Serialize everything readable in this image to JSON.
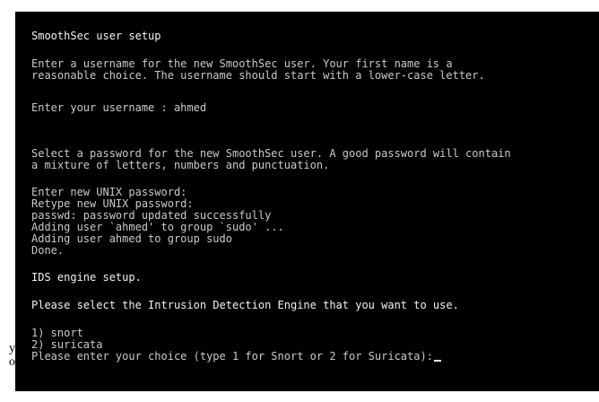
{
  "terminal": {
    "lines": [
      "SmoothSec user setup",
      "Enter a username for the new SmoothSec user. Your first name is a",
      "reasonable choice. The username should start with a lower-case letter.",
      "Enter your username : ahmed",
      "Select a password for the new SmoothSec user. A good password will contain",
      "a mixture of letters, numbers and punctuation.",
      "Enter new UNIX password:",
      "Retype new UNIX password:",
      "passwd: password updated successfully",
      "Adding user `ahmed' to group `sudo' ...",
      "Adding user ahmed to group sudo",
      "Done.",
      "IDS engine setup.",
      "Please select the Intrusion Detection Engine that you want to use.",
      "1) snort",
      "2) suricata",
      "Please enter your choice (type 1 for Snort or 2 for Suricata):"
    ]
  },
  "page_edge": {
    "fragments": [
      "y",
      "o"
    ]
  },
  "colors": {
    "background": "#000000",
    "text": "#c9c9c9",
    "text_bright": "#f2f2f2"
  }
}
